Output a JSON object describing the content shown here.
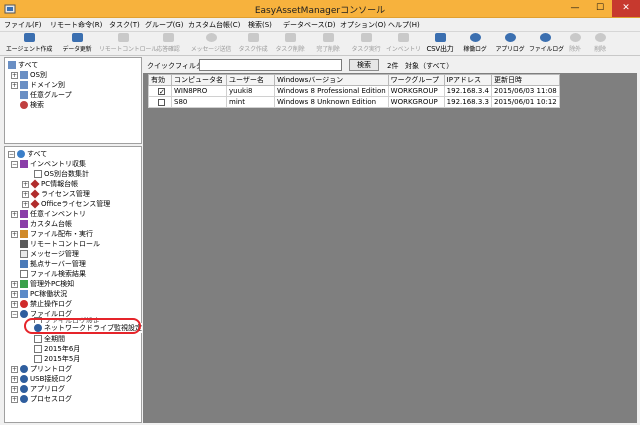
{
  "window": {
    "title": "EasyAssetManagerコンソール",
    "min": "—",
    "max": "☐",
    "close": "✕"
  },
  "menu": [
    "ファイル(F)",
    "リモート命令(R)",
    "タスク(T)",
    "グループ(G)",
    "カスタム台帳(C)",
    "検索(S)",
    "データベース(D)",
    "オプション(O)",
    "ヘルプ(H)"
  ],
  "toolbar": [
    {
      "label": "エージェント作成",
      "state": "enabled",
      "color": "#3b6fb0"
    },
    {
      "label": "データ更新",
      "state": "enabled",
      "color": "#4a84c4"
    },
    {
      "label": "リモートコントロール",
      "state": "disabled"
    },
    {
      "label": "応答確認",
      "state": "disabled"
    },
    {
      "label": "メッセージ送信",
      "state": "disabled"
    },
    {
      "label": "タスク作成",
      "state": "disabled"
    },
    {
      "label": "タスク削除",
      "state": "disabled"
    },
    {
      "label": "完了削除",
      "state": "disabled"
    },
    {
      "label": "タスク実行",
      "state": "disabled"
    },
    {
      "label": "インベントリ",
      "state": "disabled"
    },
    {
      "label": "CSV出力",
      "state": "enabled",
      "color": "#5a9bd5"
    },
    {
      "label": "稼働ログ",
      "state": "enabled",
      "color": "#2f5e9e"
    },
    {
      "label": "アプリログ",
      "state": "enabled",
      "color": "#2f5e9e"
    },
    {
      "label": "ファイルログ",
      "state": "enabled",
      "color": "#2f5e9e"
    },
    {
      "label": "除外",
      "state": "disabled"
    },
    {
      "label": "削除",
      "state": "disabled"
    }
  ],
  "tree_top": [
    {
      "label": "すべて",
      "icon": "computers-icon",
      "expander": "",
      "indent": 0
    },
    {
      "label": "OS別",
      "icon": "computers-icon",
      "expander": "+",
      "indent": 1
    },
    {
      "label": "ドメイン別",
      "icon": "computers-icon",
      "expander": "+",
      "indent": 1
    },
    {
      "label": "任意グループ",
      "icon": "computers-icon",
      "expander": "",
      "indent": 1
    },
    {
      "label": "検索",
      "icon": "search-icon",
      "expander": "",
      "indent": 1
    }
  ],
  "tree_bottom": [
    {
      "label": "すべて",
      "icon": "globe-icon",
      "expander": "−",
      "indent": 0
    },
    {
      "label": "インベントリ収集",
      "icon": "inventory-icon",
      "expander": "−",
      "indent": 1
    },
    {
      "label": "OS別台数集計",
      "icon": "page-icon",
      "expander": "",
      "indent": 2
    },
    {
      "label": "PC情報台帳",
      "icon": "diamond-icon",
      "expander": "+",
      "indent": 2
    },
    {
      "label": "ライセンス管理",
      "icon": "diamond-icon",
      "expander": "+",
      "indent": 2
    },
    {
      "label": "Officeライセンス管理",
      "icon": "diamond-icon",
      "expander": "+",
      "indent": 2
    },
    {
      "label": "任意インベントリ",
      "icon": "inventory-icon",
      "expander": "+",
      "indent": 1
    },
    {
      "label": "カスタム台帳",
      "icon": "ledger-icon",
      "expander": "",
      "indent": 1
    },
    {
      "label": "ファイル配布・実行",
      "icon": "file-icon",
      "expander": "+",
      "indent": 1
    },
    {
      "label": "リモートコントロール",
      "icon": "remote-icon",
      "expander": "",
      "indent": 1
    },
    {
      "label": "メッセージ管理",
      "icon": "message-icon",
      "expander": "",
      "indent": 1
    },
    {
      "label": "拠点サーバー管理",
      "icon": "server-icon",
      "expander": "",
      "indent": 1
    },
    {
      "label": "ファイル検索結果",
      "icon": "search-icon",
      "expander": "",
      "indent": 1
    },
    {
      "label": "管理外PC検知",
      "icon": "detect-icon",
      "expander": "+",
      "indent": 1
    },
    {
      "label": "PC稼働状況",
      "icon": "status-icon",
      "expander": "+",
      "indent": 1
    },
    {
      "label": "禁止操作ログ",
      "icon": "prohibit-icon",
      "expander": "+",
      "indent": 1
    },
    {
      "label": "ファイルログ",
      "icon": "filelog-icon",
      "expander": "−",
      "indent": 1
    },
    {
      "label": "ファイルログ設定",
      "icon": "page-icon",
      "expander": "",
      "indent": 2
    },
    {
      "label": "ネットワークドライブ監視設定",
      "icon": "network-drive-icon",
      "expander": "",
      "indent": 2
    },
    {
      "label": "全期間",
      "icon": "page-icon",
      "expander": "",
      "indent": 2
    },
    {
      "label": "2015年6月",
      "icon": "page-icon",
      "expander": "",
      "indent": 2
    },
    {
      "label": "2015年5月",
      "icon": "page-icon",
      "expander": "",
      "indent": 2
    },
    {
      "label": "プリントログ",
      "icon": "print-icon",
      "expander": "+",
      "indent": 1
    },
    {
      "label": "USB接続ログ",
      "icon": "usb-icon",
      "expander": "+",
      "indent": 1
    },
    {
      "label": "アプリログ",
      "icon": "app-icon",
      "expander": "+",
      "indent": 1
    },
    {
      "label": "プロセスログ",
      "icon": "process-icon",
      "expander": "+",
      "indent": 1
    }
  ],
  "filter": {
    "label": "クイックフィルター",
    "value": "",
    "search_button": "検索",
    "count": "2件",
    "target": "対象（すべて）"
  },
  "table": {
    "columns": [
      "有効",
      "コンピュータ名",
      "ユーザー名",
      "Windowsバージョン",
      "ワークグループ",
      "IPアドレス",
      "更新日時"
    ],
    "rows": [
      {
        "checked": true,
        "cells": [
          "WIN8PRO",
          "yuuki8",
          "Windows 8 Professional Edition",
          "WORKGROUP",
          "192.168.3.4",
          "2015/06/03 11:08"
        ]
      },
      {
        "checked": false,
        "cells": [
          "S80",
          "mint",
          "Windows 8 Unknown Edition",
          "WORKGROUP",
          "192.168.3.3",
          "2015/06/01 10:12"
        ]
      }
    ],
    "check_mark": "✓"
  },
  "colors": {
    "titlebar": "#f7b23d",
    "highlight_ring": "#e5242a",
    "grid_background": "#7f7f7f"
  }
}
